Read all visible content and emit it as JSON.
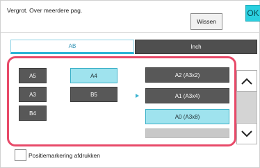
{
  "header": {
    "title": "Vergrot. Over meerdere pag.",
    "clear_label": "Wissen",
    "ok_label": "OK"
  },
  "tabs": [
    {
      "label": "AB",
      "selected": true
    },
    {
      "label": "Inch",
      "selected": false
    }
  ],
  "original_sizes": [
    {
      "label": "A5",
      "selected": false
    },
    {
      "label": "A4",
      "selected": true
    },
    {
      "label": "A3",
      "selected": false
    },
    {
      "label": "B5",
      "selected": false
    },
    {
      "label": "B4",
      "selected": false
    }
  ],
  "output_sizes": [
    {
      "label": "A2 (A3x2)",
      "selected": false
    },
    {
      "label": "A1 (A3x4)",
      "selected": false
    },
    {
      "label": "A0 (A3x8)",
      "selected": true
    }
  ],
  "icons": {
    "arrow": "arrow-right-icon",
    "scroll_up": "chevron-up-icon",
    "scroll_down": "chevron-down-icon"
  },
  "checkbox": {
    "label": "Positiemarkering afdrukken",
    "checked": false
  },
  "colors": {
    "highlight_border": "#e84a69",
    "selected_fill": "#9fe3ee",
    "accent": "#2bd0e0"
  }
}
